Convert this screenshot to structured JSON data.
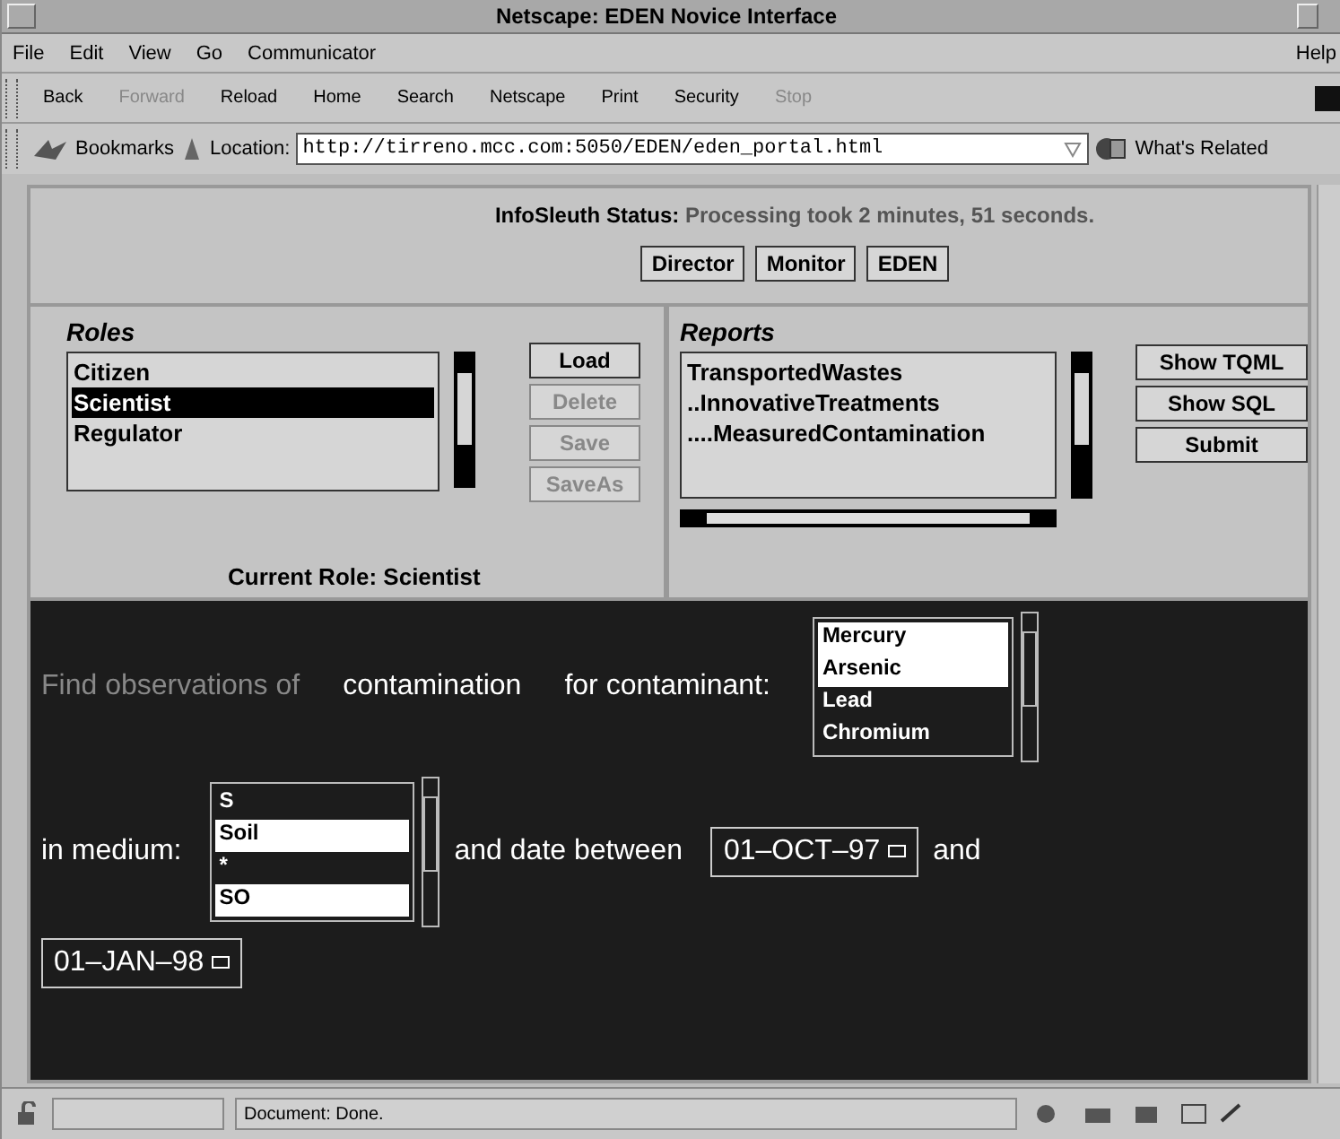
{
  "window": {
    "title": "Netscape: EDEN Novice Interface"
  },
  "menu": [
    "File",
    "Edit",
    "View",
    "Go",
    "Communicator",
    "Help"
  ],
  "toolbar": [
    {
      "label": "Back",
      "disabled": false
    },
    {
      "label": "Forward",
      "disabled": true
    },
    {
      "label": "Reload",
      "disabled": false
    },
    {
      "label": "Home",
      "disabled": false
    },
    {
      "label": "Search",
      "disabled": false
    },
    {
      "label": "Netscape",
      "disabled": false
    },
    {
      "label": "Print",
      "disabled": false
    },
    {
      "label": "Security",
      "disabled": false
    },
    {
      "label": "Stop",
      "disabled": true
    }
  ],
  "location_bar": {
    "bookmarks": "Bookmarks",
    "location_label": "Location:",
    "url": "http://tirreno.mcc.com:5050/EDEN/eden_portal.html",
    "related": "What's Related"
  },
  "status": {
    "label": "InfoSleuth Status:",
    "message": "Processing took 2 minutes, 51 seconds.",
    "buttons": [
      "Director",
      "Monitor",
      "EDEN"
    ]
  },
  "roles": {
    "title": "Roles",
    "items": [
      {
        "label": "Citizen",
        "selected": false
      },
      {
        "label": "Scientist",
        "selected": true
      },
      {
        "label": "Regulator",
        "selected": false
      }
    ],
    "buttons": [
      {
        "label": "Load",
        "disabled": false
      },
      {
        "label": "Delete",
        "disabled": true
      },
      {
        "label": "Save",
        "disabled": true
      },
      {
        "label": "SaveAs",
        "disabled": true
      }
    ],
    "current_role": "Current Role: Scientist"
  },
  "reports": {
    "title": "Reports",
    "items": [
      "TransportedWastes",
      "..InnovativeTreatments",
      "....MeasuredContamination"
    ],
    "buttons": [
      "Show TQML",
      "Show SQL",
      "Submit"
    ]
  },
  "query": {
    "intro": "Find observations of",
    "subject": "contamination",
    "contaminant_label": "for contaminant:",
    "contaminants": [
      {
        "label": "Mercury",
        "selected": true
      },
      {
        "label": "Arsenic",
        "selected": true
      },
      {
        "label": "Lead",
        "selected": false
      },
      {
        "label": "Chromium",
        "selected": false
      }
    ],
    "medium_label": "in medium:",
    "media": [
      {
        "label": "S",
        "selected": false
      },
      {
        "label": "Soil",
        "selected": true
      },
      {
        "label": "*",
        "selected": false
      },
      {
        "label": "SO",
        "selected": true
      }
    ],
    "date_label": "and date between",
    "date_from": "01–OCT–97",
    "and_label": "and",
    "date_to": "01–JAN–98"
  },
  "status_bar": {
    "message": "Document: Done."
  }
}
